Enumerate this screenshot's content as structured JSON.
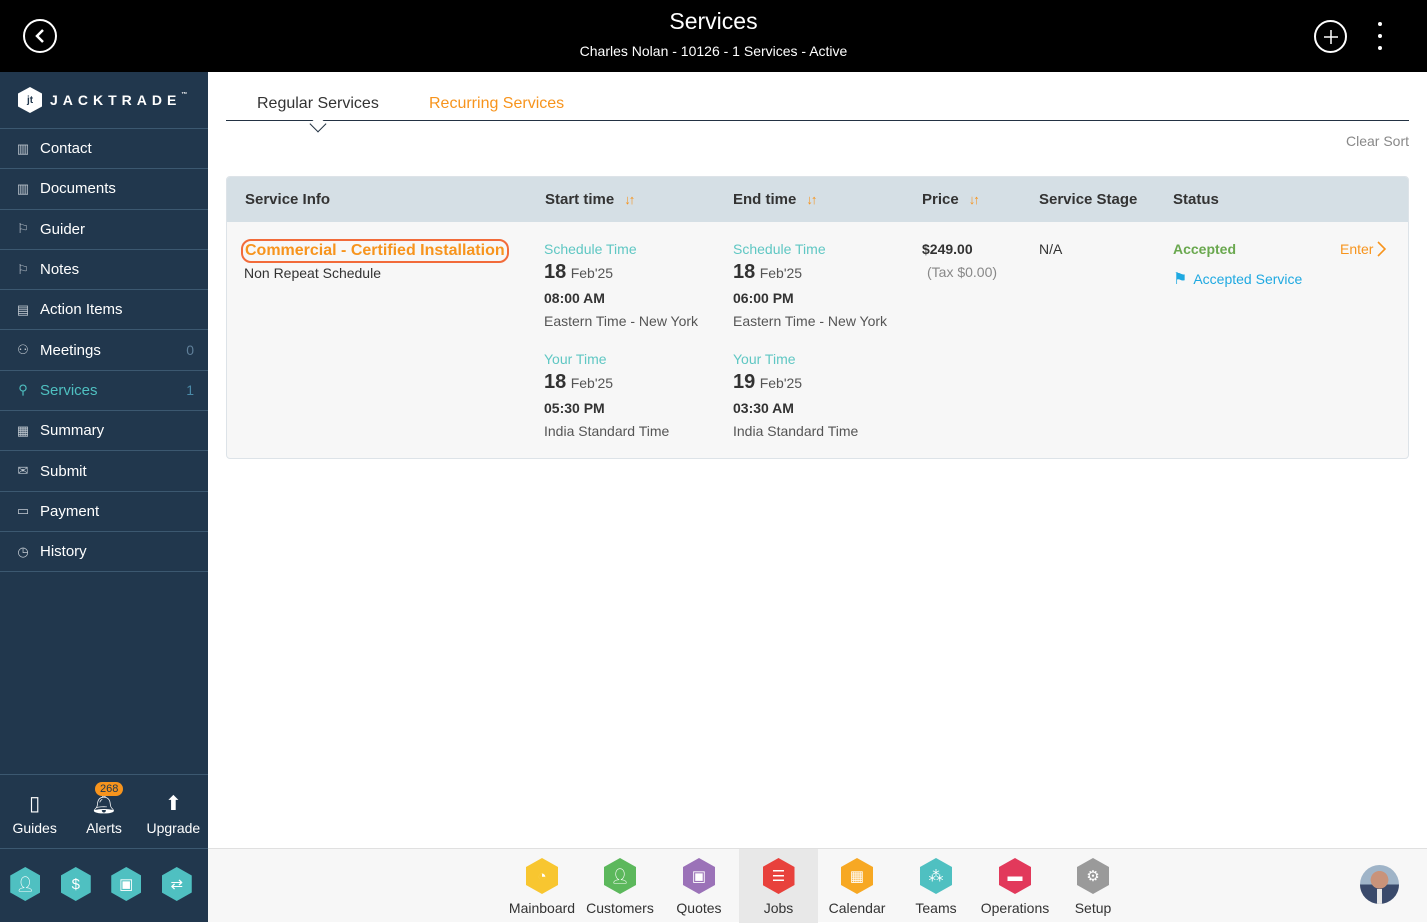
{
  "header": {
    "title": "Services",
    "subtitle": "Charles Nolan - 10126 - 1 Services - Active"
  },
  "brand": {
    "name": "JACKTRADE",
    "tm": "™"
  },
  "sidebar": {
    "items": [
      {
        "label": "Contact",
        "icon": "address-book-icon",
        "count": ""
      },
      {
        "label": "Documents",
        "icon": "address-book-icon",
        "count": ""
      },
      {
        "label": "Guider",
        "icon": "signpost-icon",
        "count": ""
      },
      {
        "label": "Notes",
        "icon": "signpost-icon",
        "count": ""
      },
      {
        "label": "Action Items",
        "icon": "clipboard-icon",
        "count": ""
      },
      {
        "label": "Meetings",
        "icon": "meeting-icon",
        "count": "0"
      },
      {
        "label": "Services",
        "icon": "service-person-icon",
        "count": "1",
        "active": true
      },
      {
        "label": "Summary",
        "icon": "documents-icon",
        "count": ""
      },
      {
        "label": "Submit",
        "icon": "send-mail-icon",
        "count": ""
      },
      {
        "label": "Payment",
        "icon": "payment-card-icon",
        "count": ""
      },
      {
        "label": "History",
        "icon": "history-icon",
        "count": ""
      }
    ],
    "tools": [
      {
        "label": "Guides",
        "icon": "book-icon"
      },
      {
        "label": "Alerts",
        "icon": "bell-icon",
        "badge": "268"
      },
      {
        "label": "Upgrade",
        "icon": "arrow-up-icon"
      }
    ],
    "quick_actions": [
      "add-contact-icon",
      "dollar-icon",
      "money-icon",
      "workflow-icon"
    ]
  },
  "tabs": {
    "regular": "Regular Services",
    "recurring": "Recurring Services",
    "active": "regular"
  },
  "clear_sort": "Clear Sort",
  "table": {
    "headers": {
      "service_info": "Service Info",
      "start_time": "Start time",
      "end_time": "End time",
      "price": "Price",
      "service_stage": "Service Stage",
      "status": "Status"
    },
    "rows": [
      {
        "name": "Commercial - Certified Installation",
        "schedule_type": "Non Repeat Schedule",
        "start": {
          "schedule": {
            "label": "Schedule Time",
            "day": "18",
            "month": "Feb'25",
            "time": "08:00 AM",
            "tz": "Eastern Time - New York"
          },
          "yours": {
            "label": "Your Time",
            "day": "18",
            "month": "Feb'25",
            "time": "05:30 PM",
            "tz": "India Standard Time"
          }
        },
        "end": {
          "schedule": {
            "label": "Schedule Time",
            "day": "18",
            "month": "Feb'25",
            "time": "06:00 PM",
            "tz": "Eastern Time - New York"
          },
          "yours": {
            "label": "Your Time",
            "day": "19",
            "month": "Feb'25",
            "time": "03:30 AM",
            "tz": "India Standard Time"
          }
        },
        "price": "$249.00",
        "tax": "(Tax $0.00)",
        "stage": "N/A",
        "status": "Accepted",
        "status_detail": "Accepted Service",
        "action": "Enter"
      }
    ]
  },
  "dock": {
    "apps": [
      {
        "label": "Mainboard",
        "color": "#f8c630",
        "icon": "dashboard-icon"
      },
      {
        "label": "Customers",
        "color": "#5cb85c",
        "icon": "customer-icon"
      },
      {
        "label": "Quotes",
        "color": "#9b72b8",
        "icon": "quotes-icon"
      },
      {
        "label": "Jobs",
        "color": "#e8413c",
        "icon": "jobs-list-icon",
        "active": true
      },
      {
        "label": "Calendar",
        "color": "#f7a823",
        "icon": "calendar-icon"
      },
      {
        "label": "Teams",
        "color": "#4fc0c1",
        "icon": "teams-icon"
      },
      {
        "label": "Operations",
        "color": "#e2395b",
        "icon": "briefcase-icon"
      },
      {
        "label": "Setup",
        "color": "#9a9a9a",
        "icon": "gear-icon"
      }
    ]
  }
}
